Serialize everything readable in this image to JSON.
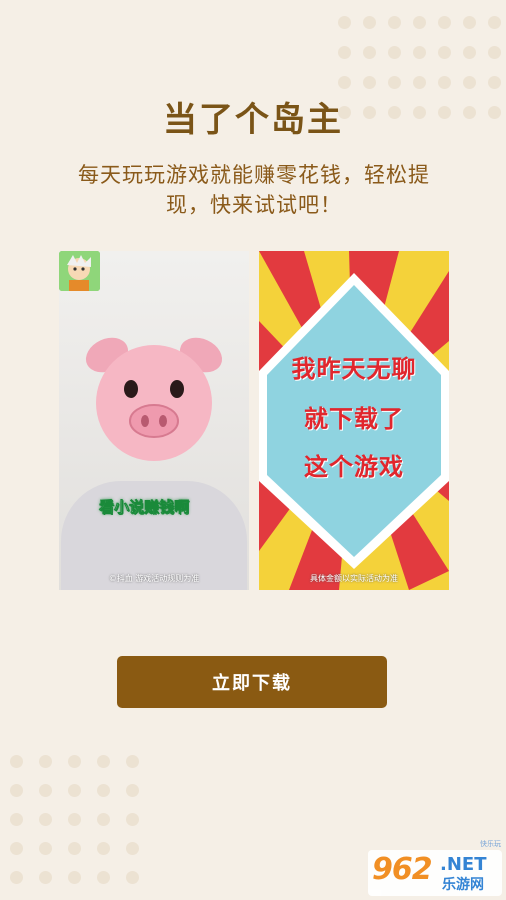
{
  "title": "当了个岛主",
  "subtitle": "每天玩玩游戏就能赚零花钱，轻松提现，快来试试吧！",
  "screenshots": {
    "left": {
      "caption": "看小说赚钱啊",
      "note": "©抖血  游戏活动规则为准"
    },
    "right": {
      "lines": [
        "我昨天无聊",
        "就下载了",
        "这个游戏"
      ],
      "note": "具体金额以实际活动为准"
    }
  },
  "download_button": "立即下载",
  "watermark": {
    "number": "962",
    "domain": ".NET",
    "site": "乐游网",
    "tiny": "快乐玩"
  },
  "colors": {
    "background": "#f5efe6",
    "accent": "#8a5a12",
    "title": "#7a5417"
  }
}
